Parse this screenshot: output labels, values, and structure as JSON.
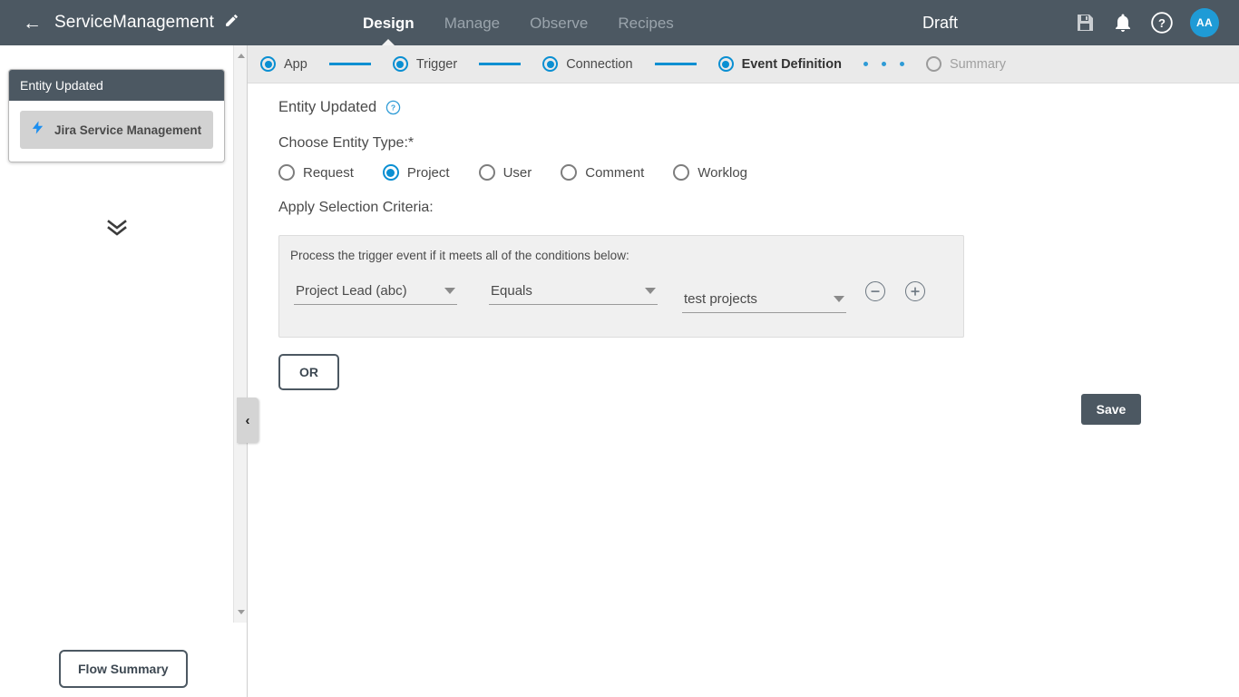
{
  "header": {
    "back_icon": "back-arrow-icon",
    "flow_name": "ServiceManagement",
    "edit_icon": "pencil-icon",
    "nav": [
      {
        "label": "Design",
        "active": true
      },
      {
        "label": "Manage",
        "active": false
      },
      {
        "label": "Observe",
        "active": false
      },
      {
        "label": "Recipes",
        "active": false
      }
    ],
    "status": "Draft",
    "save_icon": "floppy-disk-icon",
    "notification_icon": "bell-icon",
    "help_icon": "question-circle-icon",
    "avatar_initials": "AA"
  },
  "stepper": {
    "steps": [
      {
        "label": "App",
        "state": "complete"
      },
      {
        "label": "Trigger",
        "state": "complete"
      },
      {
        "label": "Connection",
        "state": "complete"
      },
      {
        "label": "Event Definition",
        "state": "current"
      },
      {
        "label": "Summary",
        "state": "pending"
      }
    ]
  },
  "left_panel": {
    "card": {
      "title": "Entity Updated",
      "app_name": "Jira Service Management",
      "app_icon": "lightning-bolt-icon"
    },
    "expand_icon": "double-chevron-down-icon",
    "collapse_icon": "chevron-left-icon",
    "flow_summary_label": "Flow Summary"
  },
  "main": {
    "section_title": "Entity Updated",
    "section_help_icon": "question-circle-icon",
    "entity_type_label": "Choose Entity Type:*",
    "entity_types": [
      {
        "label": "Request",
        "selected": false
      },
      {
        "label": "Project",
        "selected": true
      },
      {
        "label": "User",
        "selected": false
      },
      {
        "label": "Comment",
        "selected": false
      },
      {
        "label": "Worklog",
        "selected": false
      }
    ],
    "criteria_label": "Apply Selection Criteria:",
    "criteria_hint": "Process the trigger event if it meets all of the conditions below:",
    "condition": {
      "field": "Project Lead (abc)",
      "operator": "Equals",
      "value": "test projects",
      "remove_icon": "minus-circle-icon",
      "add_icon": "plus-circle-icon"
    },
    "or_label": "OR",
    "save_label": "Save"
  },
  "colors": {
    "header_bg": "#4c5862",
    "accent_blue": "#0a8fd2",
    "avatar_bg": "#1f9bd6",
    "panel_bg": "#f0f0f0",
    "stepper_bg": "#eaeaea"
  }
}
